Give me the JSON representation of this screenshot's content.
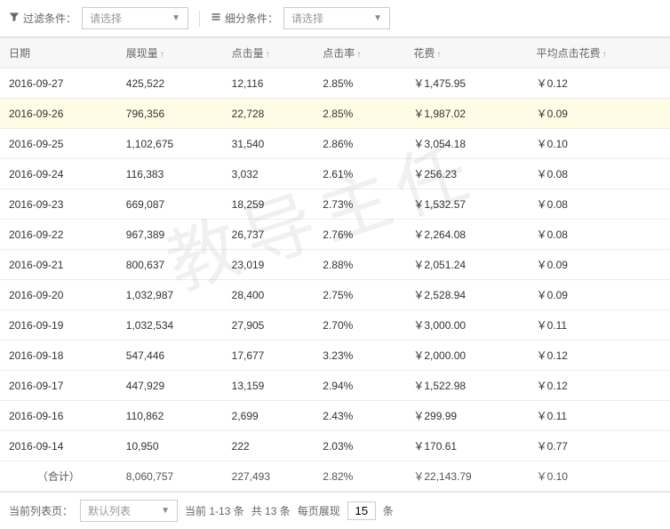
{
  "toolbar": {
    "filter_label": "过滤条件：",
    "filter_placeholder": "请选择",
    "detail_label": "细分条件：",
    "detail_placeholder": "请选择"
  },
  "columns": [
    "日期",
    "展现量",
    "点击量",
    "点击率",
    "花费",
    "平均点击花费"
  ],
  "rows": [
    {
      "date": "2016-09-27",
      "impr": "425,522",
      "clicks": "12,116",
      "ctr": "2.85%",
      "cost": "￥1,475.95",
      "cpc": "￥0.12"
    },
    {
      "date": "2016-09-26",
      "impr": "796,356",
      "clicks": "22,728",
      "ctr": "2.85%",
      "cost": "￥1,987.02",
      "cpc": "￥0.09",
      "highlight": true
    },
    {
      "date": "2016-09-25",
      "impr": "1,102,675",
      "clicks": "31,540",
      "ctr": "2.86%",
      "cost": "￥3,054.18",
      "cpc": "￥0.10"
    },
    {
      "date": "2016-09-24",
      "impr": "116,383",
      "clicks": "3,032",
      "ctr": "2.61%",
      "cost": "￥256.23",
      "cpc": "￥0.08"
    },
    {
      "date": "2016-09-23",
      "impr": "669,087",
      "clicks": "18,259",
      "ctr": "2.73%",
      "cost": "￥1,532.57",
      "cpc": "￥0.08"
    },
    {
      "date": "2016-09-22",
      "impr": "967,389",
      "clicks": "26,737",
      "ctr": "2.76%",
      "cost": "￥2,264.08",
      "cpc": "￥0.08"
    },
    {
      "date": "2016-09-21",
      "impr": "800,637",
      "clicks": "23,019",
      "ctr": "2.88%",
      "cost": "￥2,051.24",
      "cpc": "￥0.09"
    },
    {
      "date": "2016-09-20",
      "impr": "1,032,987",
      "clicks": "28,400",
      "ctr": "2.75%",
      "cost": "￥2,528.94",
      "cpc": "￥0.09"
    },
    {
      "date": "2016-09-19",
      "impr": "1,032,534",
      "clicks": "27,905",
      "ctr": "2.70%",
      "cost": "￥3,000.00",
      "cpc": "￥0.11"
    },
    {
      "date": "2016-09-18",
      "impr": "547,446",
      "clicks": "17,677",
      "ctr": "3.23%",
      "cost": "￥2,000.00",
      "cpc": "￥0.12"
    },
    {
      "date": "2016-09-17",
      "impr": "447,929",
      "clicks": "13,159",
      "ctr": "2.94%",
      "cost": "￥1,522.98",
      "cpc": "￥0.12"
    },
    {
      "date": "2016-09-16",
      "impr": "110,862",
      "clicks": "2,699",
      "ctr": "2.43%",
      "cost": "￥299.99",
      "cpc": "￥0.11"
    },
    {
      "date": "2016-09-14",
      "impr": "10,950",
      "clicks": "222",
      "ctr": "2.03%",
      "cost": "￥170.61",
      "cpc": "￥0.77"
    }
  ],
  "total": {
    "label": "（合计）",
    "impr": "8,060,757",
    "clicks": "227,493",
    "ctr": "2.82%",
    "cost": "￥22,143.79",
    "cpc": "￥0.10"
  },
  "footer": {
    "list_label": "当前列表页：",
    "list_dropdown": "默认列表",
    "range": "当前 1-13 条",
    "total": "共 13 条",
    "perpage_label": "每页展现",
    "perpage_value": "15",
    "unit": "条"
  },
  "watermark": "教导主任"
}
